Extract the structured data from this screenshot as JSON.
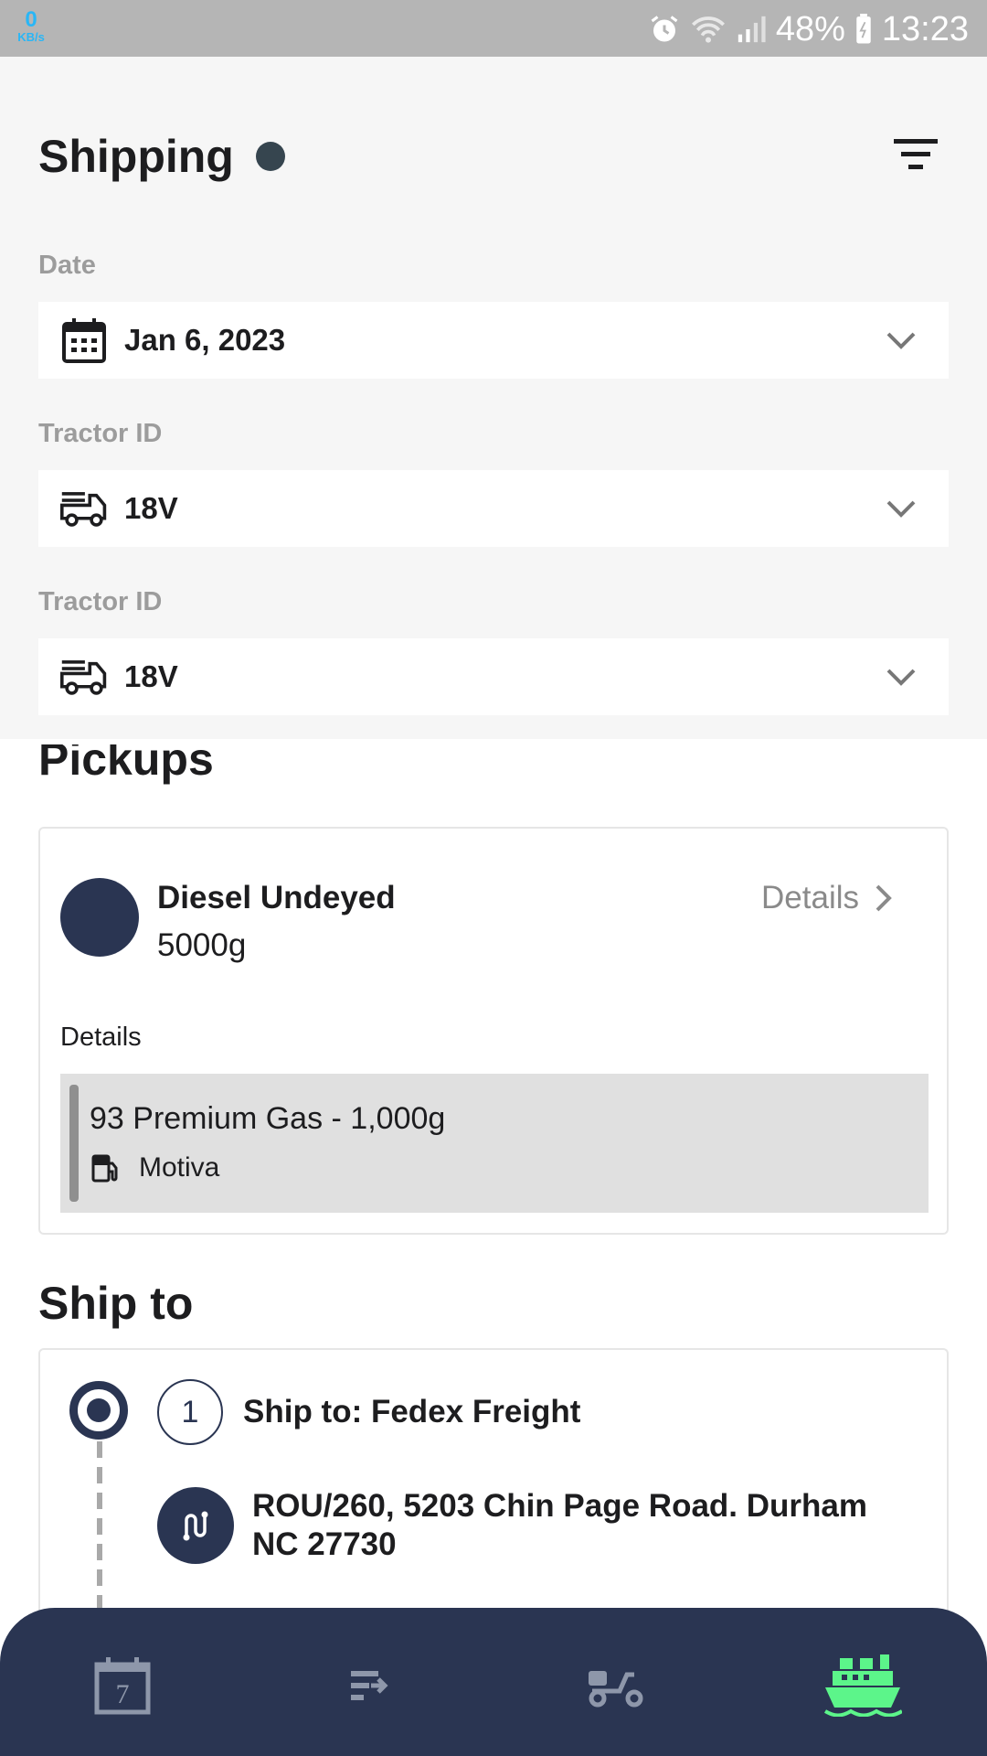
{
  "status_bar": {
    "net_speed_value": "0",
    "net_speed_unit": "KB/s",
    "battery": "48%",
    "time": "13:23"
  },
  "header": {
    "title": "Shipping"
  },
  "fields": {
    "date_label": "Date",
    "date_value": "Jan 6, 2023",
    "tractor_label_1": "Tractor ID",
    "tractor_value_1": "18V",
    "tractor_label_2": "Tractor ID",
    "tractor_value_2": "18V"
  },
  "pickups": {
    "heading": "Pickups",
    "item": {
      "name": "Diesel Undeyed",
      "quantity": "5000g",
      "details_link": "Details",
      "details_label": "Details",
      "detail_title": "93 Premium Gas - 1,000g",
      "detail_vendor": "Motiva"
    }
  },
  "ship_to": {
    "heading": "Ship to",
    "stop": {
      "number": "1",
      "title": "Ship to: Fedex Freight",
      "address": "ROU/260, 5203 Chin Page Road. Durham NC 27730"
    }
  },
  "bottom_nav": {
    "calendar_day": "7",
    "items": [
      "calendar-icon",
      "schedule-icon",
      "scooter-icon",
      "ship-icon"
    ],
    "active_color": "#5cf58a",
    "inactive_color": "#8e97aa"
  },
  "colors": {
    "navy": "#2a3552",
    "background": "#f6f6f6"
  }
}
